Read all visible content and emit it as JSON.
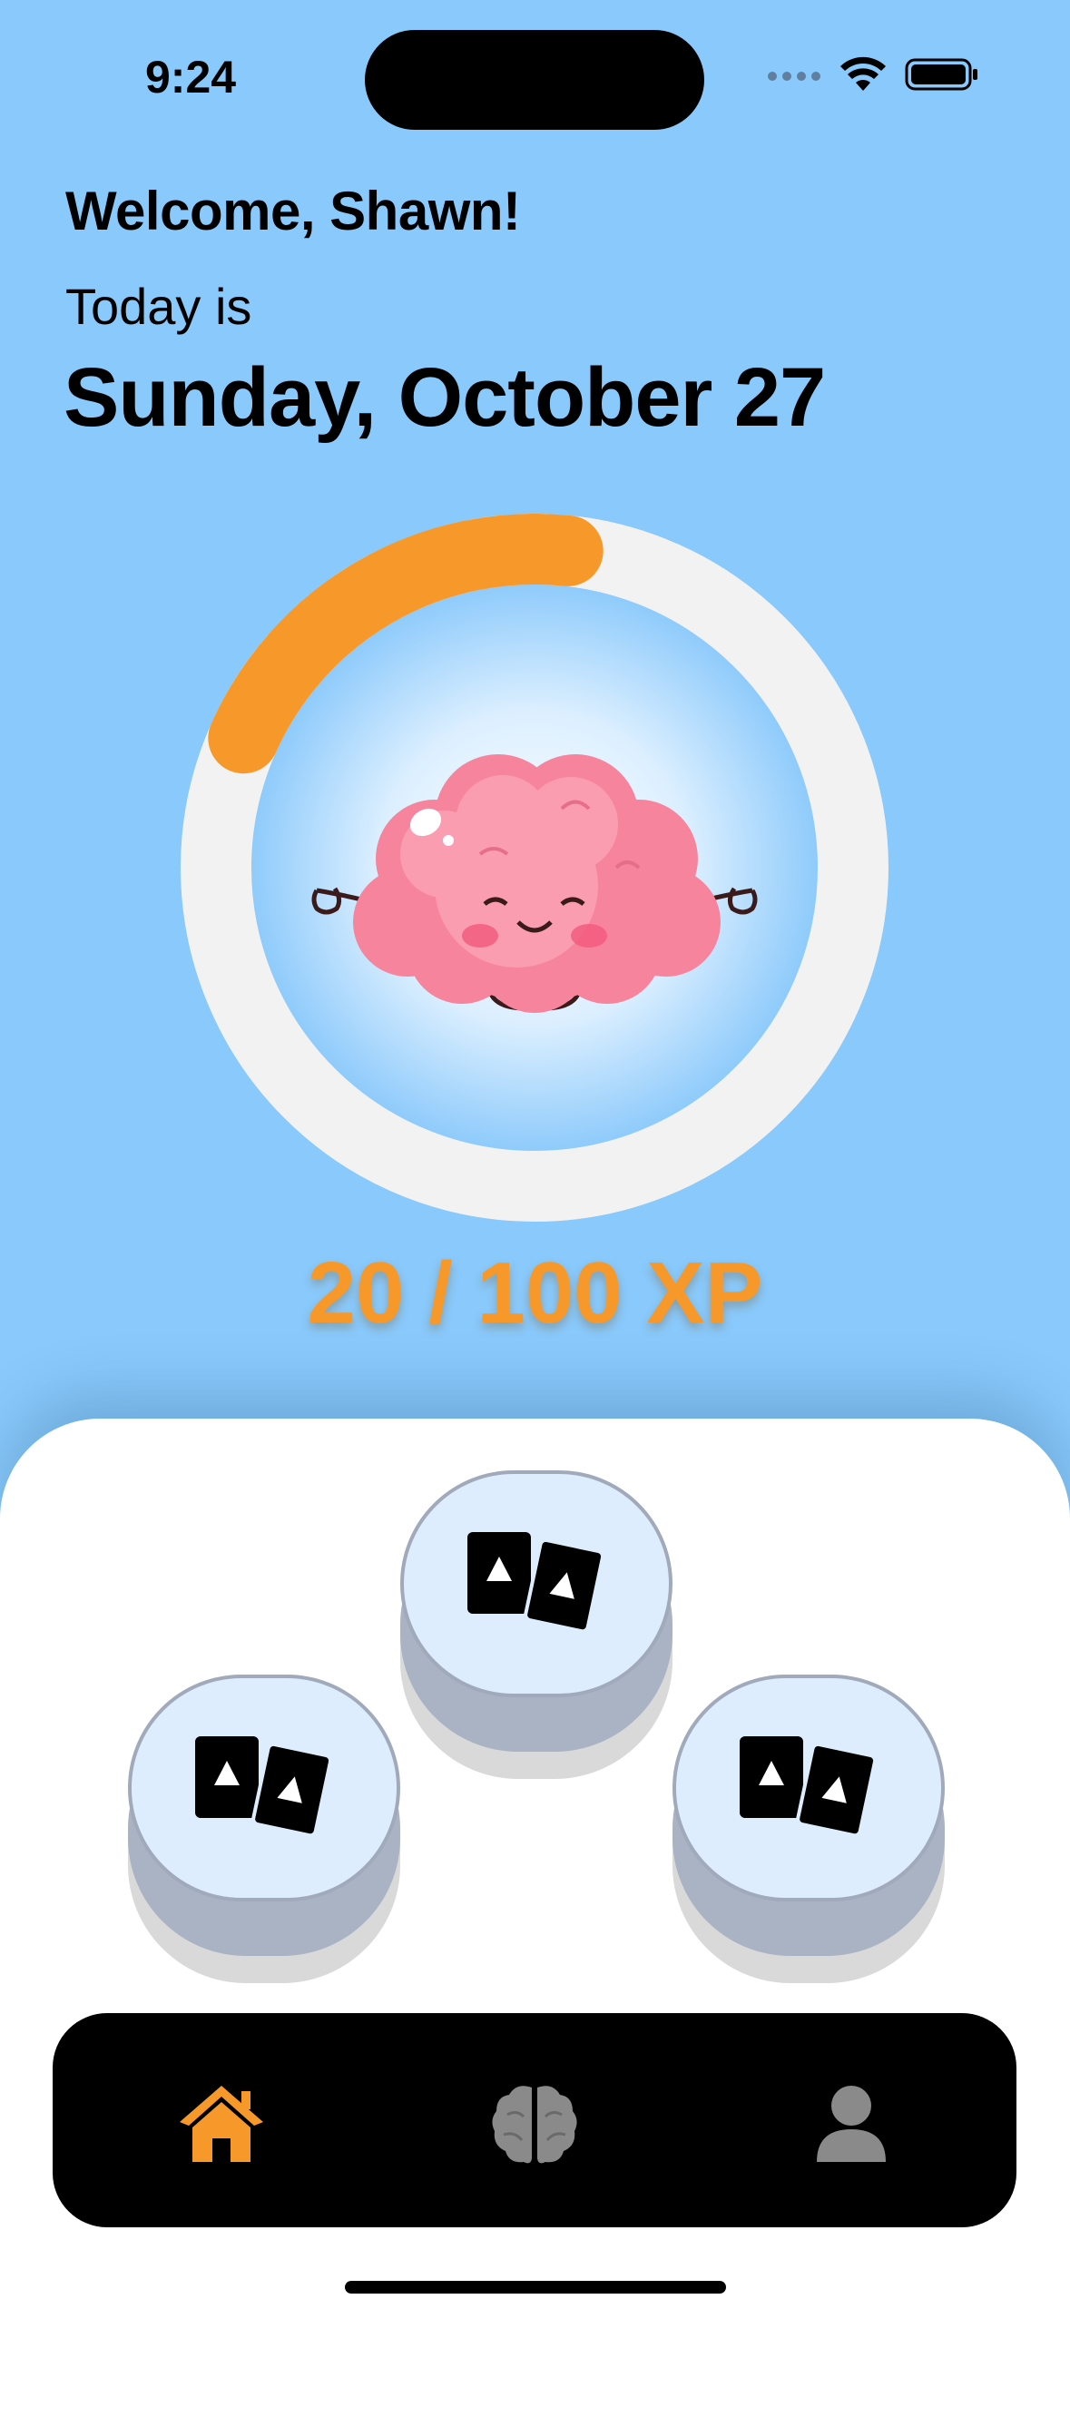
{
  "status_bar": {
    "time": "9:24"
  },
  "header": {
    "welcome": "Welcome, Shawn!",
    "today_prefix": "Today is",
    "date": "Sunday, October 27"
  },
  "progress": {
    "xp_text": "20 / 100 XP",
    "current": 20,
    "max": 100,
    "arc_color": "#f7992a",
    "track_color": "#f2f2f2"
  },
  "lessons": [
    {
      "icon": "cards-icon"
    },
    {
      "icon": "cards-icon"
    },
    {
      "icon": "cards-icon"
    }
  ],
  "tabbar": {
    "items": [
      {
        "icon": "home-icon",
        "active": true,
        "color": "#f7992a"
      },
      {
        "icon": "brain-icon",
        "active": false,
        "color": "#8a8a8a"
      },
      {
        "icon": "person-icon",
        "active": false,
        "color": "#8a8a8a"
      }
    ]
  },
  "colors": {
    "background": "#89c9fb",
    "accent": "#f7992a"
  }
}
